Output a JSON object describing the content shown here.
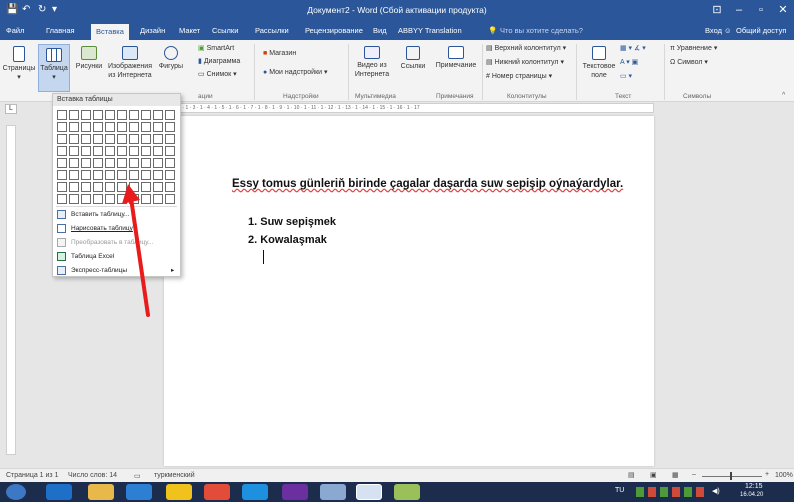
{
  "window": {
    "title": "Документ2 - Word (Сбой активации продукта)",
    "quick_access": [
      "💾",
      "↶",
      "↻",
      "▾"
    ],
    "controls": [
      "⊡",
      "–",
      "▫",
      "✕"
    ]
  },
  "tabs": [
    "Файл",
    "Главная",
    "Вставка",
    "Дизайн",
    "Макет",
    "Ссылки",
    "Рассылки",
    "Рецензирование",
    "Вид",
    "ABBYY Translation"
  ],
  "tell_me": "Что вы хотите сделать?",
  "signin": "Вход",
  "share": "Общий доступ",
  "ribbon": {
    "pages": "Страницы",
    "table": "Таблица",
    "pictures": "Рисунки",
    "online_pictures": "Изображения из Интернета",
    "shapes": "Фигуры",
    "smartart": "SmartArt",
    "chart": "Диаграмма",
    "screenshot": "Снимок",
    "store": "Магазин",
    "my_addins": "Мои надстройки",
    "online_video": "Видео из Интернета",
    "links": "Ссылки",
    "comment": "Примечание",
    "header": "Верхний колонтитул",
    "footer": "Нижний колонтитул",
    "page_number": "Номер страницы",
    "textbox": "Текстовое поле",
    "equation": "Уравнение",
    "symbol": "Символ",
    "groups": {
      "illustrations": "ации",
      "addins": "Надстройки",
      "media": "Мультимедиа",
      "comments": "Примечания",
      "header_footer": "Колонтитулы",
      "text": "Текст",
      "symbols": "Символы"
    }
  },
  "ruler_text": "1 · 2 · 1 · 3 · 1 · 4 · 1 · 5 · 1 · 6 · 1 · 7 · 1 · 8 · 1 · 9 · 1 · 10 · 1 · 11 · 1 · 12 · 1 · 13 · 1 · 14 · 1 · 15 · 1 · 16 · 1 · 17",
  "dropdown": {
    "header": "Вставка таблицы",
    "grid_cells": 80,
    "items": [
      {
        "label": "Вставить таблицу...",
        "enabled": true
      },
      {
        "label": "Нарисовать таблицу",
        "enabled": true
      },
      {
        "label": "Преобразовать в таблицу...",
        "enabled": false
      },
      {
        "label": "Таблица Excel",
        "enabled": true
      },
      {
        "label": "Экспресс-таблицы",
        "enabled": true,
        "submenu": "▸"
      }
    ]
  },
  "document": {
    "paragraph": "Essy tomus günleriň birinde çagalar daşarda suw sepişip oýnaýardylar.",
    "list": [
      "1. Suw sepişmek",
      "2. Kowalaşmak"
    ]
  },
  "status": {
    "page": "Страница 1 из 1",
    "words": "Число слов: 14",
    "language": "туркменский",
    "zoom": "100%"
  },
  "taskbar": {
    "lang": "TU",
    "time": "12:15",
    "date": "16.04.20"
  },
  "colors": {
    "accent": "#2b579a",
    "arrow": "#e81c1c"
  }
}
